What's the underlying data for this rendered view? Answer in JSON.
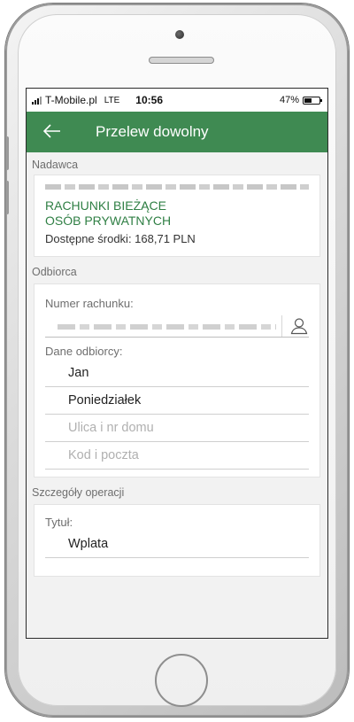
{
  "status_bar": {
    "carrier": "T-Mobile.pl",
    "network": "LTE",
    "time": "10:56",
    "battery": "47%",
    "battery_level": 0.47
  },
  "app_bar": {
    "title": "Przelew dowolny"
  },
  "sender": {
    "section_label": "Nadawca",
    "account_name_line1": "RACHUNKI BIEŻĄCE",
    "account_name_line2": "OSÓB PRYWATNYCH",
    "available_funds": "Dostępne środki: 168,71 PLN"
  },
  "recipient": {
    "section_label": "Odbiorca",
    "account_number_label": "Numer rachunku:",
    "recipient_data_label": "Dane odbiorcy:",
    "first_name": "Jan",
    "last_name": "Poniedziałek",
    "street_placeholder": "Ulica i nr domu",
    "postcode_placeholder": "Kod i poczta"
  },
  "operation": {
    "section_label": "Szczegóły operacji",
    "title_label": "Tytuł:",
    "title_value": "Wplata"
  },
  "colors": {
    "brand_green": "#3f8a52",
    "account_green": "#2f7f44"
  }
}
